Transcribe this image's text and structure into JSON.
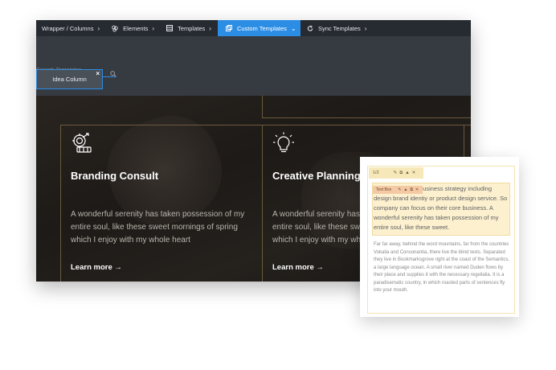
{
  "toolbar": {
    "items": [
      {
        "label": "Wrapper / Columns",
        "icon": "none",
        "chevron": "›"
      },
      {
        "label": "Elements",
        "icon": "elements-icon",
        "chevron": "›"
      },
      {
        "label": "Templates",
        "icon": "template-icon",
        "chevron": "›"
      },
      {
        "label": "Custom Templates",
        "icon": "custom-template-icon",
        "chevron": "⌄",
        "active": true
      },
      {
        "label": "Sync Templates",
        "icon": "sync-icon",
        "chevron": "›"
      }
    ]
  },
  "panel": {
    "search_placeholder": "Search Templates",
    "template_item": "Idea Column",
    "close_glyph": "×"
  },
  "cards": [
    {
      "title": "Branding Consult",
      "description": "A wonderful serenity has taken possession of my entire soul, like these sweet mornings of spring which I enjoy with my whole heart",
      "link": "Learn more  →"
    },
    {
      "title": "Creative Planning",
      "description": "A wonderful serenity has taken possession of my entire soul, like these sweet mornings of spring which I enjoy with my whole heart",
      "link": "Learn more  →"
    }
  ],
  "textbox": {
    "column_chip": "1/2",
    "tag": "Text Box",
    "selected_text": "We easily set up business strategy including design brand identiy or product design service. So company can focus on their core business. A wonderful serenity has taken possession of my entire soul, like these sweet.",
    "secondary_text": "Far far away, behind the word mountains, far from the countries Vokalia and Consonantia, there live the blind texts. Separated they live in Bookmarksgrove right at the coast of the Semantics, a large language ocean. A small river named Duden flows by their place and supplies it with the necessary regelialia. It is a paradisematic country, in which roasted parts of sentences fly into your mouth."
  },
  "colors": {
    "toolbar_bg": "#262a31",
    "active_tab": "#2c8de4",
    "panel_bg": "#363b42",
    "gold_border": "#6b5a3c",
    "selection_highlight": "#fcf0cf"
  }
}
